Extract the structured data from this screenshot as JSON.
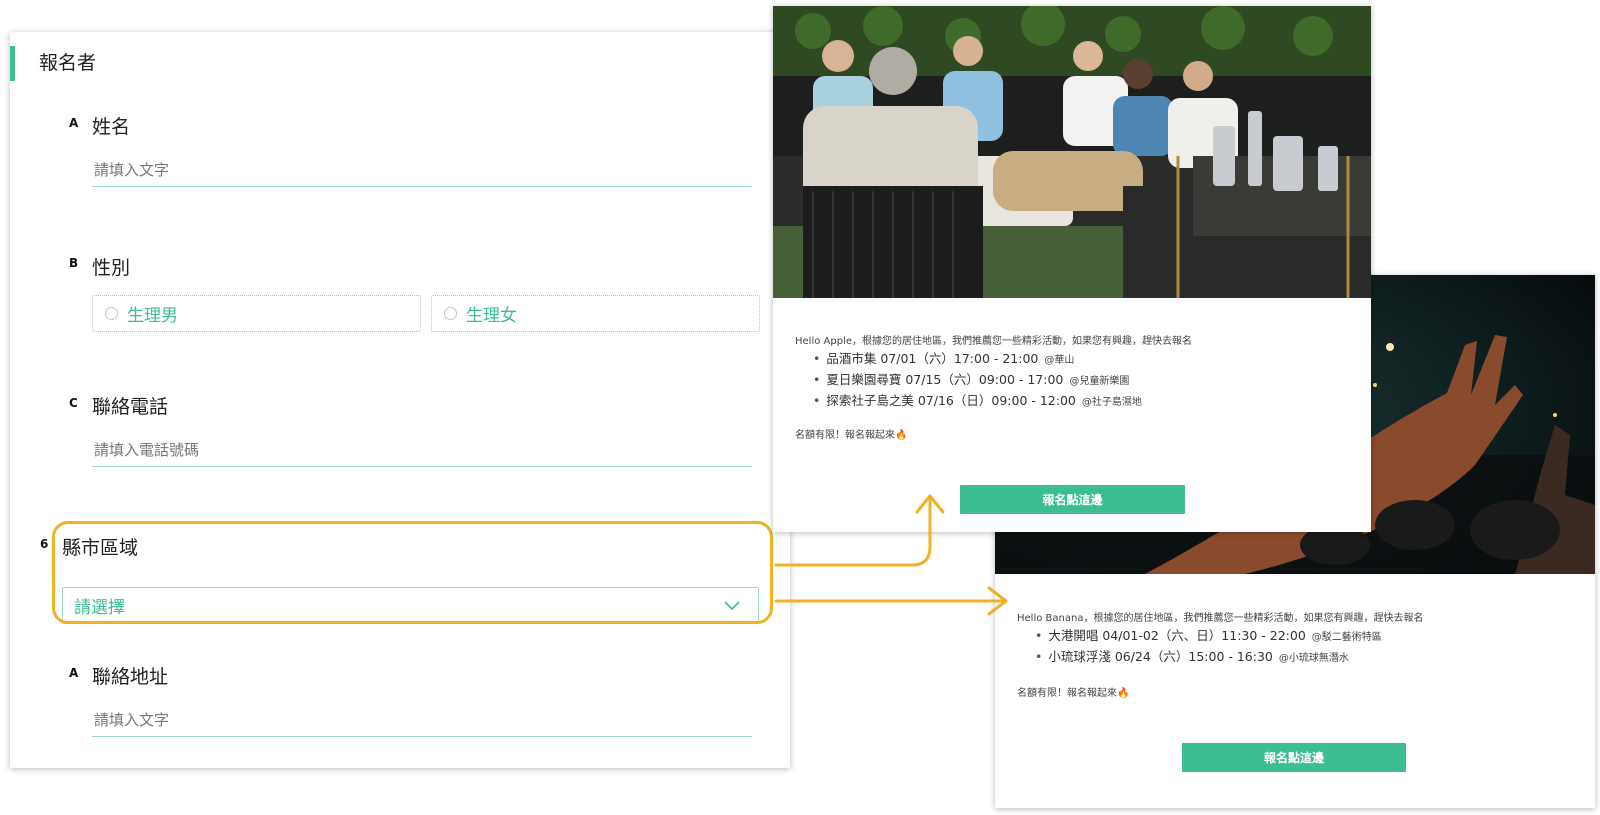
{
  "form": {
    "section_title": "報名者",
    "questions": [
      {
        "letter": "A",
        "label": "姓名",
        "placeholder": "請填入文字"
      },
      {
        "letter": "B",
        "label": "性別",
        "options": [
          "生理男",
          "生理女"
        ]
      },
      {
        "letter": "C",
        "label": "聯絡電話",
        "placeholder": "請填入電話號碼"
      },
      {
        "letter": "6",
        "label": "縣市區域",
        "select_value": "請選擇"
      },
      {
        "letter": "A",
        "label": "聯絡地址",
        "placeholder": "請填入文字"
      }
    ]
  },
  "emails": [
    {
      "greeting": "Hello Apple，根據您的居住地區，我們推薦您一些精彩活動，如果您有興趣，趕快去報名",
      "events": [
        {
          "text": "品酒市集 07/01（六）17:00 - 21:00",
          "venue": "@華山"
        },
        {
          "text": "夏日樂園尋寶 07/15（六）09:00 - 17:00",
          "venue": "@兒童新樂園"
        },
        {
          "text": "探索社子島之美 07/16（日）09:00 - 12:00",
          "venue": "@社子島濕地"
        }
      ],
      "limit": "名額有限！報名報起來🔥",
      "cta": "報名點這邊"
    },
    {
      "greeting": "Hello Banana，根據您的居住地區，我們推薦您一些精彩活動，如果您有興趣，趕快去報名",
      "events": [
        {
          "text": "大港開唱 04/01-02（六、日）11:30 - 22:00",
          "venue": "@駁二藝術特區"
        },
        {
          "text": "小琉球浮淺 06/24（六）15:00 - 16:30",
          "venue": "@小琉球無潛水"
        }
      ],
      "limit": "名額有限！報名報起來🔥",
      "cta": "報名點這邊"
    }
  ],
  "colors": {
    "accent": "#3dbd92",
    "highlight": "#f0b124"
  },
  "icons": [
    "chevron-down-icon",
    "arrow-right-icon",
    "arrow-up-icon"
  ]
}
